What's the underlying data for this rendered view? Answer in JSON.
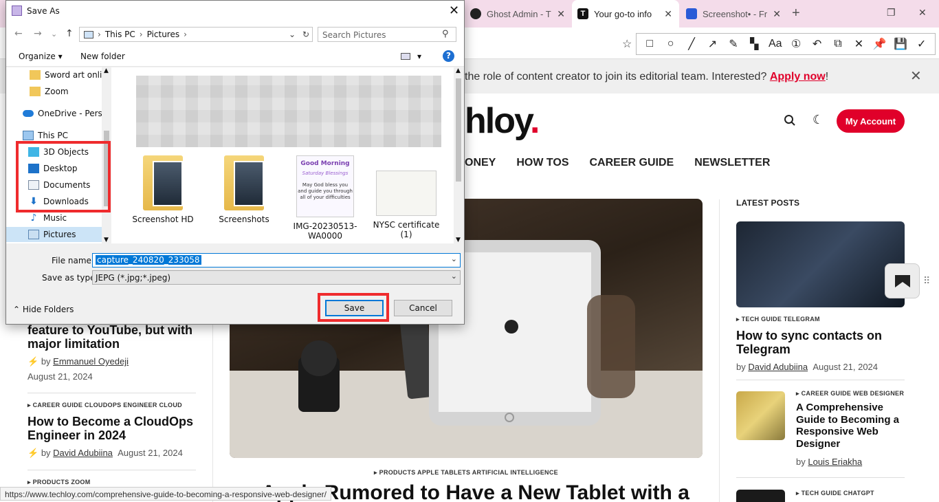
{
  "browser": {
    "tabs": [
      {
        "label": "Ghost Admin - T"
      },
      {
        "label": "Your go-to info"
      },
      {
        "label": "Screenshot• - Fr"
      }
    ],
    "status_url": "https://www.techloy.com/comprehensive-guide-to-becoming-a-responsive-web-designer/"
  },
  "site": {
    "notice_text": "the role of content creator to join its editorial team. Interested?",
    "notice_apply": "Apply now",
    "notice_end": "!",
    "logo_text": "hloy",
    "logo_dot": ".",
    "account_button": "My Account",
    "nav": [
      "ONEY",
      "HOW TOS",
      "CAREER GUIDE",
      "NEWSLETTER"
    ],
    "left_posts": [
      {
        "title": "feature to YouTube, but with major limitation",
        "by": "by",
        "author": "Emmanuel Oyedeji",
        "date": "August 21, 2024"
      },
      {
        "tags": "CAREER GUIDE  CLOUDOPS ENGINEER  CLOUD",
        "title": "How to Become a CloudOps Engineer in 2024",
        "by": "by",
        "author": "David Adubiina",
        "date": "August 21, 2024"
      },
      {
        "tags": "PRODUCTS  ZOOM"
      }
    ],
    "hero": {
      "tags": "PRODUCTS  APPLE  TABLETS  ARTIFICIAL INTELLIGENCE",
      "title": "Apple Rumored to Have a New Tablet with a"
    },
    "latest_heading": "LATEST POSTS",
    "right_posts": [
      {
        "tags": "TECH GUIDE  TELEGRAM",
        "title": "How to sync contacts on Telegram",
        "by": "by",
        "author": "David Adubiina",
        "date": "August 21, 2024"
      },
      {
        "tags": "CAREER GUIDE  WEB DESIGNER",
        "title": "A Comprehensive Guide to Becoming a Responsive Web Designer",
        "by": "by",
        "author": "Louis Eriakha"
      },
      {
        "tags": "TECH GUIDE  CHATGPT"
      }
    ]
  },
  "dialog": {
    "title": "Save As",
    "breadcrumb": [
      "This PC",
      "Pictures"
    ],
    "search_placeholder": "Search Pictures",
    "organize": "Organize",
    "new_folder": "New folder",
    "help": "?",
    "nav_items": [
      {
        "label": "Sword art online",
        "icon": "folder-icon"
      },
      {
        "label": "Zoom",
        "icon": "folder-icon"
      },
      {
        "label": "OneDrive - Person",
        "icon": "cloud-icon"
      },
      {
        "label": "This PC",
        "icon": "computer-icon"
      },
      {
        "label": "3D Objects",
        "icon": "cube-icon"
      },
      {
        "label": "Desktop",
        "icon": "desktop-icon"
      },
      {
        "label": "Documents",
        "icon": "document-icon"
      },
      {
        "label": "Downloads",
        "icon": "download-icon"
      },
      {
        "label": "Music",
        "icon": "music-icon"
      },
      {
        "label": "Pictures",
        "icon": "pictures-icon"
      }
    ],
    "files": [
      {
        "name": "Screenshot HD"
      },
      {
        "name": "Screenshots"
      },
      {
        "name": "IMG-20230513-WA0000"
      },
      {
        "name": "NYSC certificate (1)"
      }
    ],
    "photo_text": {
      "greeting": "Good Morning",
      "day": "Saturday Blessings",
      "line1": "May God bless you",
      "line2": "and guide you through",
      "line3": "all of your difficulties"
    },
    "file_name_label": "File name:",
    "file_name_value": "capture_240820_233058",
    "save_type_label": "Save as type:",
    "save_type_value": "JEPG (*.jpg;*.jpeg)",
    "hide_folders": "Hide Folders",
    "save_button": "Save",
    "cancel_button": "Cancel"
  },
  "colors": {
    "accent_red": "#e0002a",
    "highlight_red": "#ef2b2d",
    "windows_blue": "#0078d7"
  }
}
